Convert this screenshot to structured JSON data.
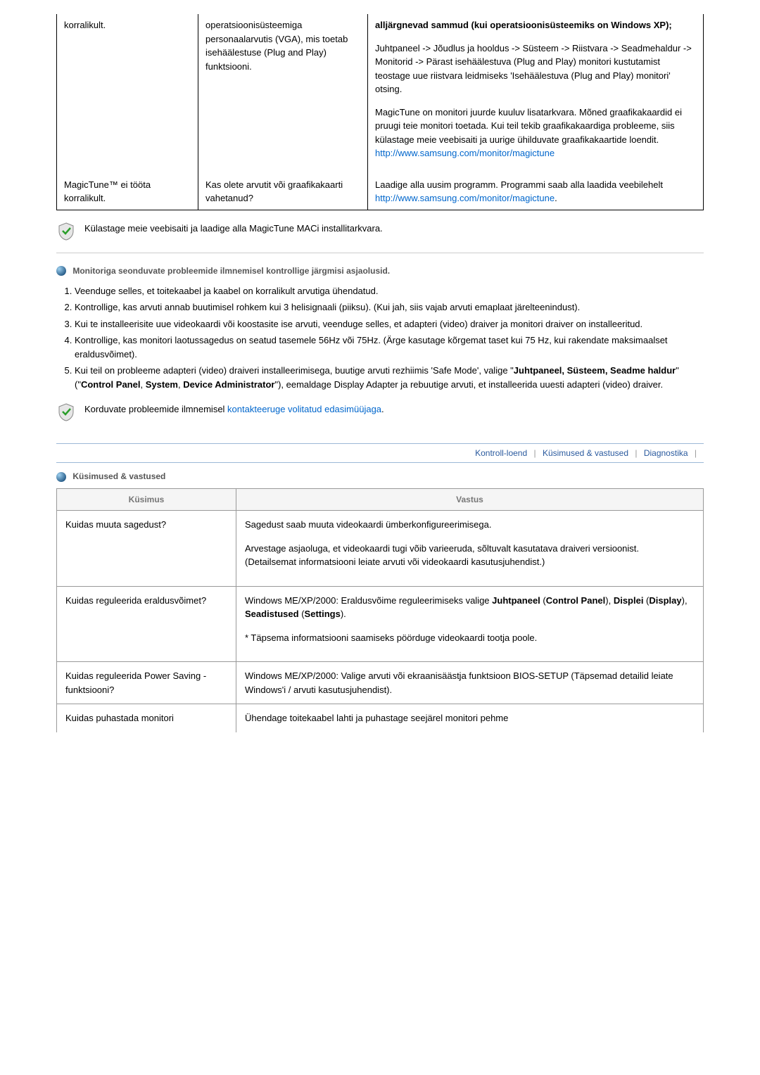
{
  "table1": {
    "rows": [
      {
        "c1": "korralikult.",
        "c2": "operatsioonisüsteemiga personaalarvutis (VGA), mis toetab isehäälestuse (Plug and Play) funktsiooni.",
        "c3_head": "alljärgnevad sammud (kui operatsioonisüsteemiks on Windows XP);",
        "c3_p1": "Juhtpaneel -> Jõudlus ja hooldus -> Süsteem -> Riistvara -> Seadmehaldur -> Monitorid -> Pärast isehäälestuva (Plug and Play) monitori kustutamist teostage uue riistvara leidmiseks 'Isehäälestuva (Plug and Play) monitori' otsing.",
        "c3_p2": "MagicTune on monitori juurde kuuluv lisatarkvara. Mõned graafikakaardid ei pruugi teie monitori toetada. Kui teil tekib graafikakaardiga probleeme, siis külastage meie veebisaiti ja uurige ühilduvate graafikakaartide loendit.",
        "c3_link": "http://www.samsung.com/monitor/magictune"
      },
      {
        "c1": "MagicTune™ ei tööta korralikult.",
        "c2": "Kas olete arvutit või graafikakaarti vahetanud?",
        "c3": "Laadige alla uusim programm. Programmi saab alla laadida veebilehelt",
        "c3_link": "http://www.samsung.com/monitor/magictune"
      }
    ]
  },
  "info1": "Külastage meie veebisaiti ja laadige alla MagicTune MACi installitarkvara.",
  "checklist": {
    "heading": "Monitoriga seonduvate probleemide ilmnemisel kontrollige järgmisi asjaolusid.",
    "items": [
      "Veenduge selles, et toitekaabel ja kaabel on korralikult arvutiga ühendatud.",
      "Kontrollige, kas arvuti annab buutimisel rohkem kui 3 helisignaali (piiksu).\n(Kui jah, siis vajab arvuti emaplaat järelteenindust).",
      "Kui te installeerisite uue videokaardi või koostasite ise arvuti, veenduge selles, et adapteri (video) draiver ja monitori draiver on installeeritud.",
      "Kontrollige, kas monitori laotussagedus on seatud tasemele 56Hz või 75Hz.\n(Ärge kasutage kõrgemat taset kui 75 Hz, kui rakendate maksimaalset eraldusvõimet).",
      "Kui teil on probleeme adapteri (video) draiveri installeerimisega, buutige arvuti rezhiimis 'Safe Mode', valige \"Juhtpaneel, Süsteem, Seadme haldur\" (\"Control Panel, System, Device Administrator\"), eemaldage Display Adapter ja rebuutige arvuti, et installeerida uuesti adapteri (video) draiver."
    ]
  },
  "info2_prefix": "Korduvate probleemide ilmnemisel ",
  "info2_link": "kontakteeruge volitatud edasimüüjaga",
  "tabs": {
    "t1": "Kontroll-loend",
    "t2": "Küsimused & vastused",
    "t3": "Diagnostika"
  },
  "qa": {
    "title": "Küsimused & vastused",
    "headers": {
      "q": "Küsimus",
      "a": "Vastus"
    },
    "rows": [
      {
        "q": "Kuidas muuta sagedust?",
        "a1": "Sagedust saab muuta videokaardi ümberkonfigureerimisega.",
        "a2": "Arvestage asjaoluga, et videokaardi tugi võib varieeruda, sõltuvalt kasutatava draiveri versioonist.\n(Detailsemat informatsiooni leiate arvuti või videokaardi kasutusjuhendist.)"
      },
      {
        "q": "Kuidas reguleerida eraldusvõimet?",
        "a1_pre": "Windows ME/XP/2000: Eraldusvõime reguleerimiseks valige ",
        "a1_b1": "Juhtpaneel",
        "a1_m1": " (",
        "a1_b2": "Control Panel",
        "a1_m2": "), ",
        "a1_b3": "Displei",
        "a1_m3": " (",
        "a1_b4": "Display",
        "a1_m4": "), ",
        "a1_b5": "Seadistused",
        "a1_m5": " (",
        "a1_b6": "Settings",
        "a1_m6": ").",
        "a2": "* Täpsema informatsiooni saamiseks pöörduge videokaardi tootja poole."
      },
      {
        "q": "Kuidas reguleerida Power Saving -funktsiooni?",
        "a": "Windows ME/XP/2000: Valige arvuti või ekraanisäästja funktsioon BIOS-SETUP (Täpsemad detailid leiate Windows'i / arvuti kasutusjuhendist)."
      },
      {
        "q": "Kuidas puhastada monitori",
        "a": "Ühendage toitekaabel lahti ja puhastage seejärel monitori pehme"
      }
    ]
  }
}
